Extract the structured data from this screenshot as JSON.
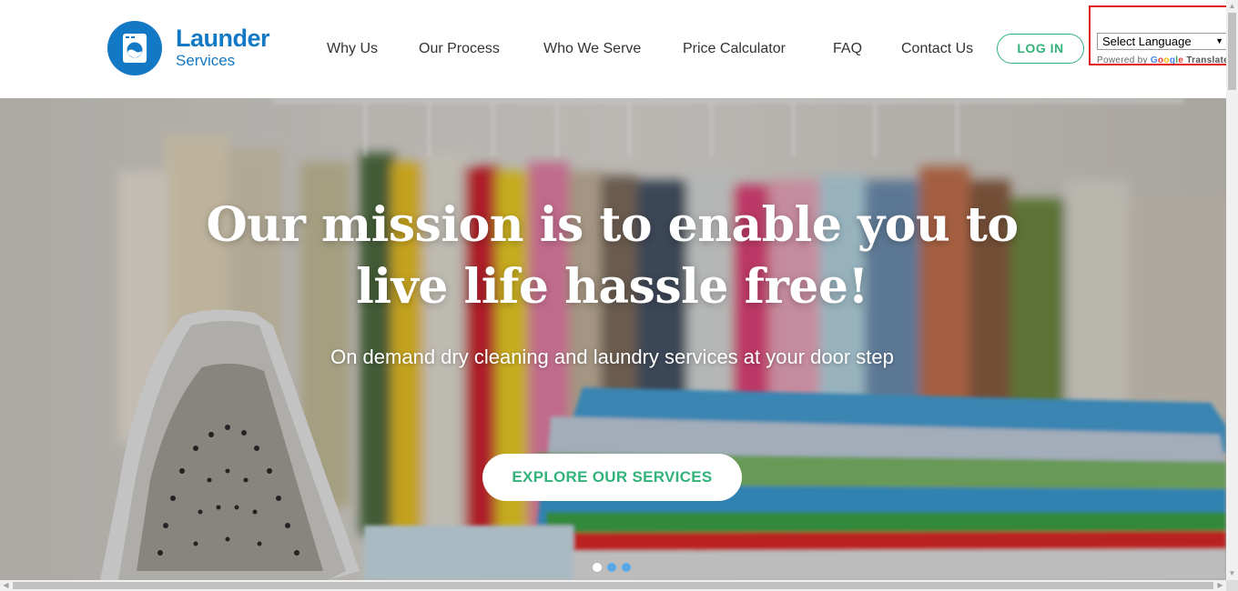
{
  "brand": {
    "name": "Launder",
    "tagline": "Services",
    "color": "#1479c4"
  },
  "nav": {
    "items": [
      {
        "label": "Why Us"
      },
      {
        "label": "Our Process"
      },
      {
        "label": "Who We Serve"
      },
      {
        "label": "Price Calculator"
      },
      {
        "label": "FAQ"
      },
      {
        "label": "Contact Us"
      }
    ],
    "login_label": "LOG IN",
    "accent": "#33b27a"
  },
  "translate": {
    "selected": "Select Language",
    "dropdown_arrow": "▼",
    "powered_by": "Powered by",
    "google": [
      "G",
      "o",
      "o",
      "g",
      "l",
      "e"
    ],
    "translate_label": "Translate",
    "highlight_color": "#e3181d"
  },
  "hero": {
    "title_line1": "Our mission is to enable you to",
    "title_line2": "live life hassle free!",
    "subtitle": "On demand dry cleaning and laundry services at your door step",
    "cta_label": "EXPLORE OUR SERVICES",
    "slides": [
      {
        "state": "active",
        "color": "#ffffff"
      },
      {
        "state": "inactive",
        "color": "#5aa9e6"
      },
      {
        "state": "inactive",
        "color": "#5aa9e6"
      }
    ]
  },
  "scrollbars": {
    "up_arrow": "▲",
    "down_arrow": "▼",
    "left_arrow": "◀",
    "right_arrow": "▶"
  }
}
